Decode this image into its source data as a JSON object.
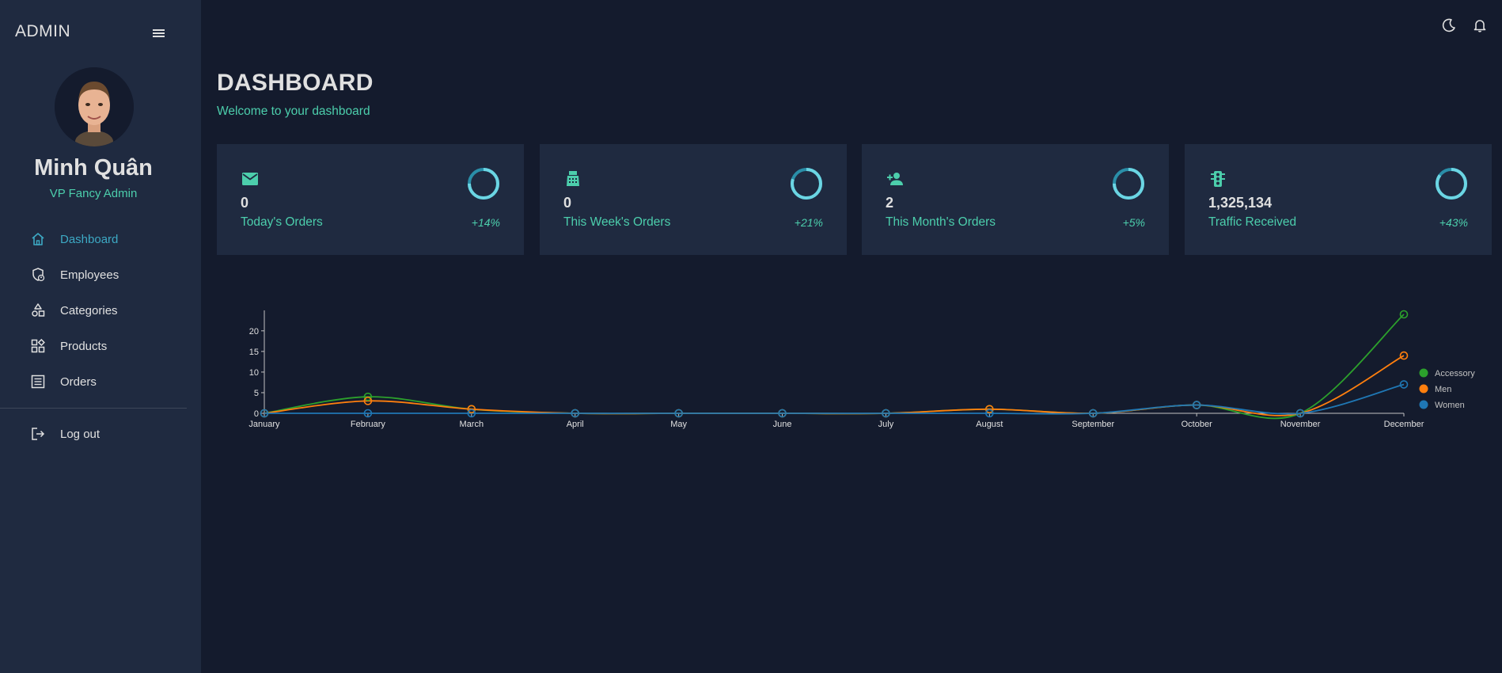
{
  "sidebar": {
    "brand": "ADMIN",
    "user": {
      "name": "Minh Quân",
      "role": "VP Fancy Admin"
    },
    "items": [
      {
        "label": "Dashboard",
        "icon": "home-icon",
        "active": true
      },
      {
        "label": "Employees",
        "icon": "employees-icon",
        "active": false
      },
      {
        "label": "Categories",
        "icon": "categories-icon",
        "active": false
      },
      {
        "label": "Products",
        "icon": "products-icon",
        "active": false
      },
      {
        "label": "Orders",
        "icon": "orders-icon",
        "active": false
      }
    ],
    "logout": {
      "label": "Log out",
      "icon": "logout-icon"
    }
  },
  "topbar": {
    "icons": [
      "dark-mode-icon",
      "notifications-icon"
    ]
  },
  "header": {
    "title": "DASHBOARD",
    "subtitle": "Welcome to your dashboard"
  },
  "cards": [
    {
      "icon": "email-icon",
      "value": "0",
      "label": "Today's Orders",
      "change": "+14%",
      "progress": 0.75
    },
    {
      "icon": "point-of-sale-icon",
      "value": "0",
      "label": "This Week's Orders",
      "change": "+21%",
      "progress": 0.8
    },
    {
      "icon": "person-add-icon",
      "value": "2",
      "label": "This Month's Orders",
      "change": "+5%",
      "progress": 0.75
    },
    {
      "icon": "traffic-icon",
      "value": "1,325,134",
      "label": "Traffic Received",
      "change": "+43%",
      "progress": 0.85
    }
  ],
  "colors": {
    "accent": "#4cceac",
    "active_nav": "#3da9c4",
    "panel": "#1f2a40",
    "background": "#141b2d",
    "ring": "#6bd5e3",
    "ring_track": "#2a8ea8"
  },
  "chart_data": {
    "type": "line",
    "categories": [
      "January",
      "February",
      "March",
      "April",
      "May",
      "June",
      "July",
      "August",
      "September",
      "October",
      "November",
      "December"
    ],
    "series": [
      {
        "name": "Accessory",
        "color": "#2ca02c",
        "values": [
          0,
          4,
          1,
          0,
          0,
          0,
          0,
          1,
          0,
          2,
          0,
          24
        ]
      },
      {
        "name": "Men",
        "color": "#ff7f0e",
        "values": [
          0,
          3,
          1,
          0,
          0,
          0,
          0,
          1,
          0,
          2,
          0,
          14
        ]
      },
      {
        "name": "Women",
        "color": "#1f77b4",
        "values": [
          0,
          0,
          0,
          0,
          0,
          0,
          0,
          0,
          0,
          2,
          0,
          7
        ]
      }
    ],
    "yticks": [
      0,
      5,
      10,
      15,
      20
    ],
    "ylim": [
      0,
      24
    ],
    "legend_position": "right",
    "grid": false
  }
}
